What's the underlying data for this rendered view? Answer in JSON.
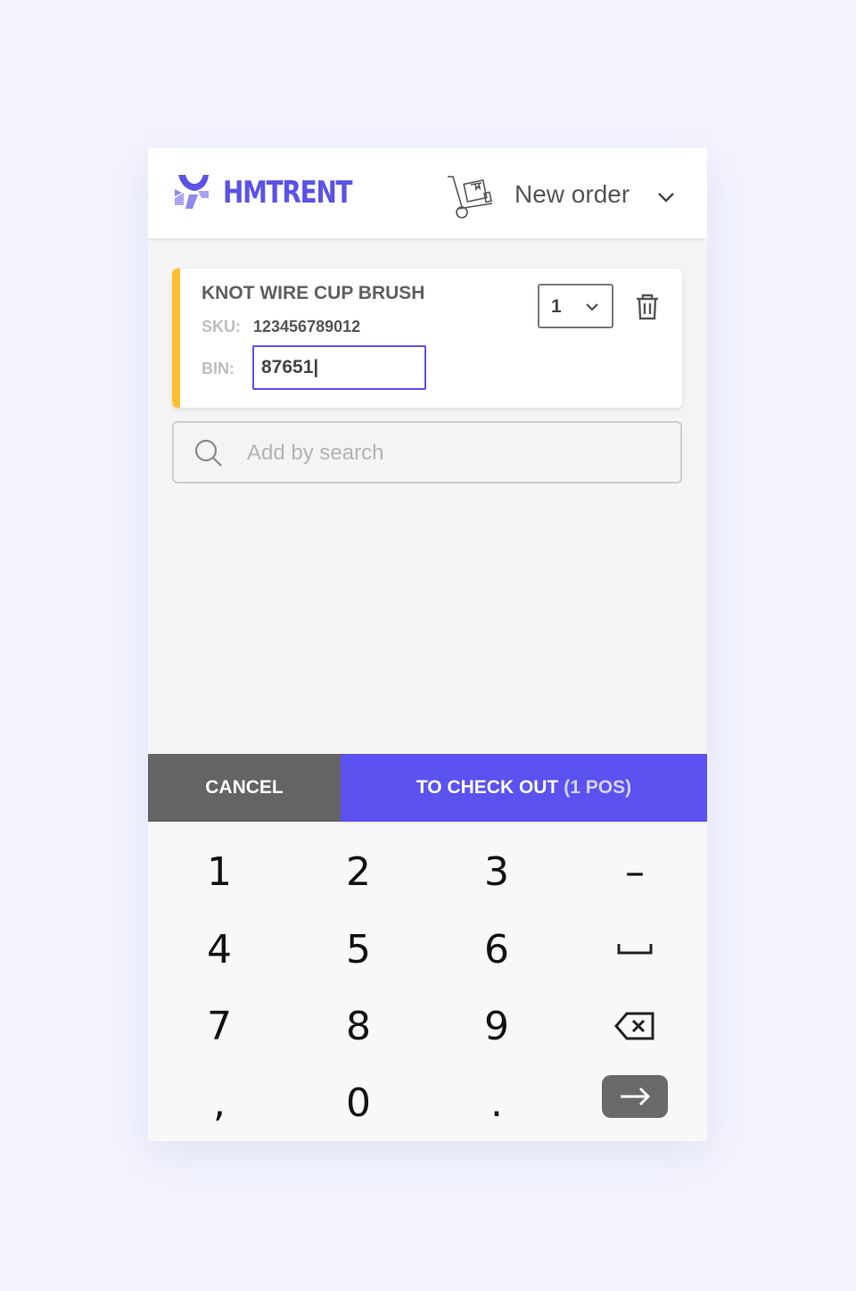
{
  "header": {
    "brand": "HMTRENT",
    "order_label": "New order",
    "brand_color": "#5b52e6",
    "icons": [
      "logo-mark",
      "hand-truck-icon",
      "chevron-down-icon"
    ]
  },
  "item": {
    "title": "KNOT WIRE CUP BRUSH",
    "sku_label": "SKU:",
    "sku": "123456789012",
    "bin_label": "BIN:",
    "bin_value": "87651|",
    "quantity": "1",
    "accent_color": "#fbc02d"
  },
  "search": {
    "placeholder": "Add by search"
  },
  "actions": {
    "cancel": "CANCEL",
    "checkout": "TO CHECK OUT",
    "checkout_count": "(1 POS)",
    "checkout_color": "#5b52f0"
  },
  "keypad": {
    "keys": [
      "1",
      "2",
      "3",
      "–",
      "4",
      "5",
      "6",
      "␣",
      "7",
      "8",
      "9",
      "⌫",
      ",",
      "0",
      ".",
      "→"
    ]
  }
}
